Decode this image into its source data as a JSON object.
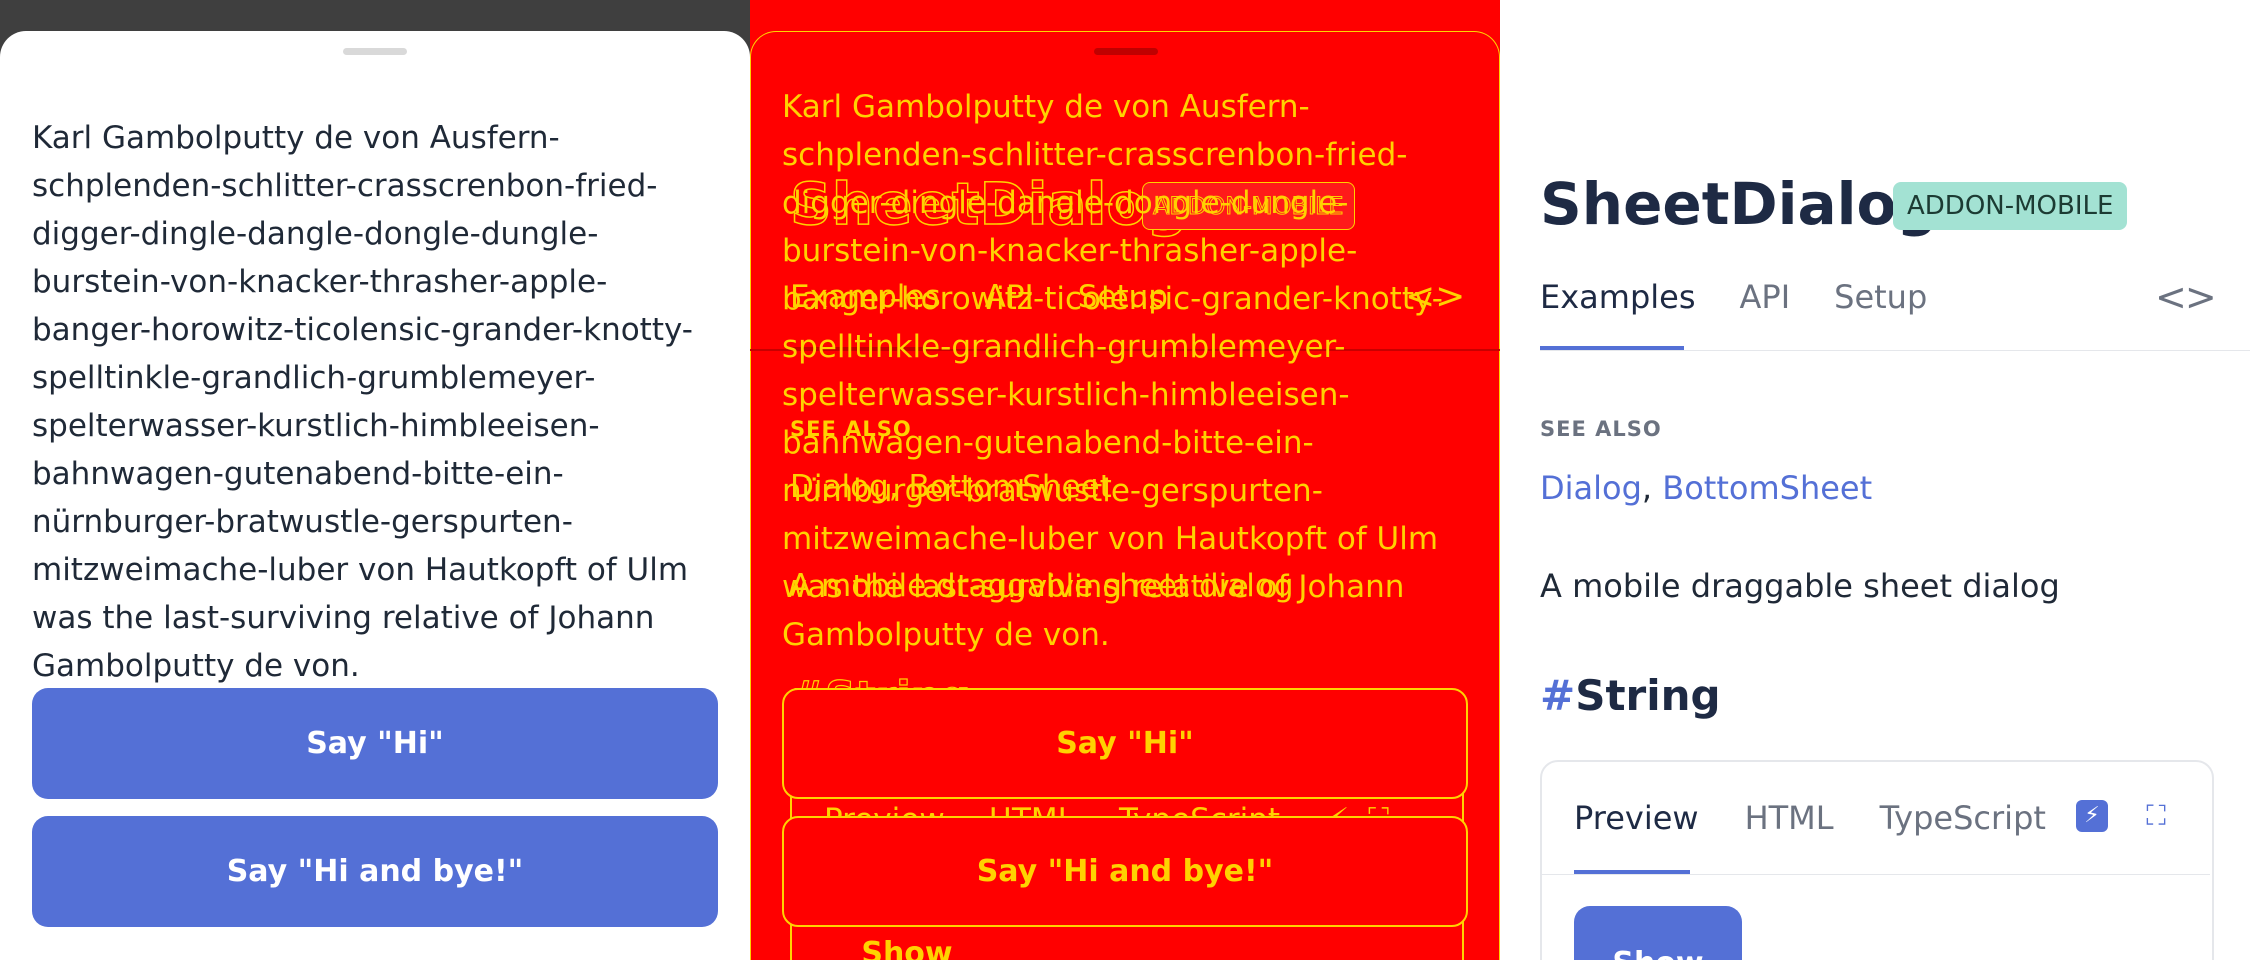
{
  "sheet": {
    "text": "Karl Gambolputty de von Ausfern-schplenden-schlitter-crasscrenbon-fried-digger-dingle-dangle-dongle-dungle-burstein-von-knacker-thrasher-apple-banger-horowitz-ticolensic-grander-knotty-spelltinkle-grandlich-grumblemeyer-spelterwasser-kurstlich-himbleeisen-bahnwagen-gutenabend-bitte-ein-nürnburger-bratwustle-gerspurten-mitzweimache-luber von Hautkopft of Ulm was the last-surviving relative of Johann Gambolputty de von.",
    "button1": "Say \"Hi\"",
    "button2": "Say \"Hi and bye!\""
  },
  "page": {
    "title": "SheetDialog",
    "badge": "ADDON-MOBILE",
    "tabs": [
      "Examples",
      "API",
      "Setup"
    ],
    "code_toggle": "<>",
    "see_also_label": "SEE ALSO",
    "see_also_link1": "Dialog",
    "see_also_sep": ", ",
    "see_also_link2": "BottomSheet",
    "description": "A mobile draggable sheet dialog",
    "section_hash": "#",
    "section_title": "String"
  },
  "code_box": {
    "tabs": [
      "Preview",
      "HTML",
      "TypeScript"
    ],
    "show_button": "Show"
  },
  "icons": {
    "handle": "drag-handle-icon",
    "code": "code-icon",
    "bolt": "lightning-icon",
    "expand": "expand-icon"
  },
  "colors": {
    "accent": "#5470d6",
    "badge_bg": "#a3e2d3",
    "overlay_red": "#ff0000",
    "overlay_yellow": "#ffd200",
    "backdrop": "#3f3f3f"
  }
}
